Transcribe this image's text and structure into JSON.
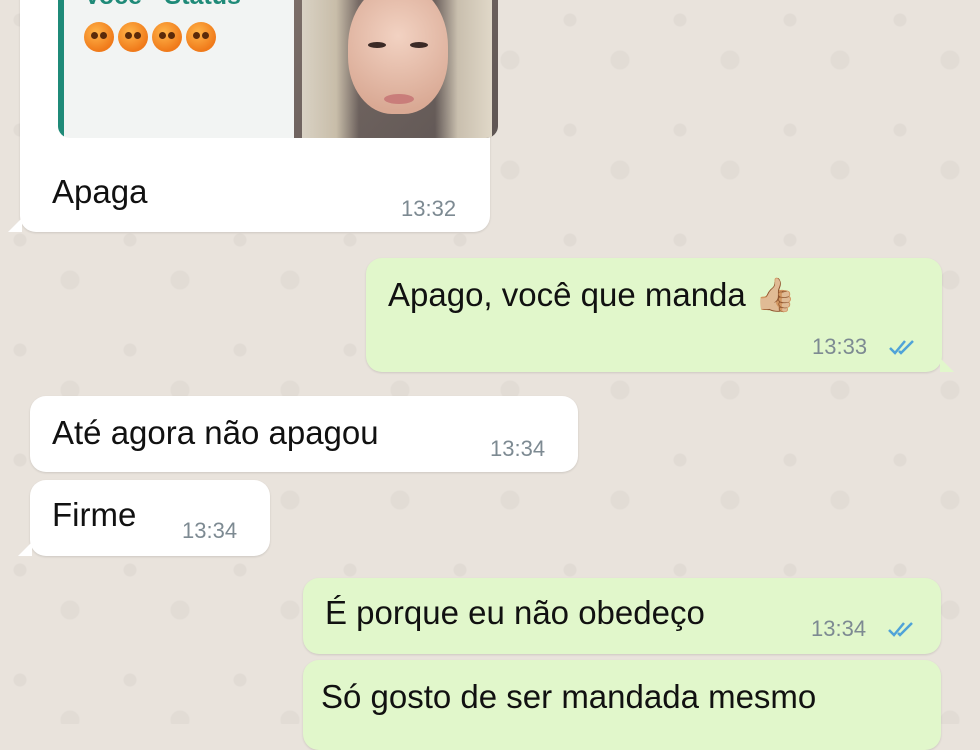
{
  "messages": [
    {
      "direction": "incoming",
      "quoted": {
        "author": "Você • Status",
        "emoji_icons": [
          "angry-face",
          "angry-face",
          "angry-face",
          "angry-face"
        ],
        "thumbnail": "photo of a woman with blonde hair"
      },
      "text": "Apaga",
      "time": "13:32"
    },
    {
      "direction": "outgoing",
      "text": "Apago, você que manda 👍🏼",
      "time": "13:33",
      "status_icon": "double-check-read"
    },
    {
      "direction": "incoming",
      "text": "Até agora não apagou",
      "time": "13:34"
    },
    {
      "direction": "incoming",
      "text": "Firme",
      "time": "13:34"
    },
    {
      "direction": "outgoing",
      "text": "É porque eu não obedeço",
      "time": "13:34",
      "status_icon": "double-check-read"
    },
    {
      "direction": "outgoing",
      "text": "Só gosto de ser mandada mesmo",
      "time": ""
    }
  ],
  "colors": {
    "incoming_bubble": "#ffffff",
    "outgoing_bubble": "#e1f7cb",
    "quote_accent": "#1f8a78",
    "read_ticks": "#4fa3d8",
    "background": "#e9e3dc"
  }
}
